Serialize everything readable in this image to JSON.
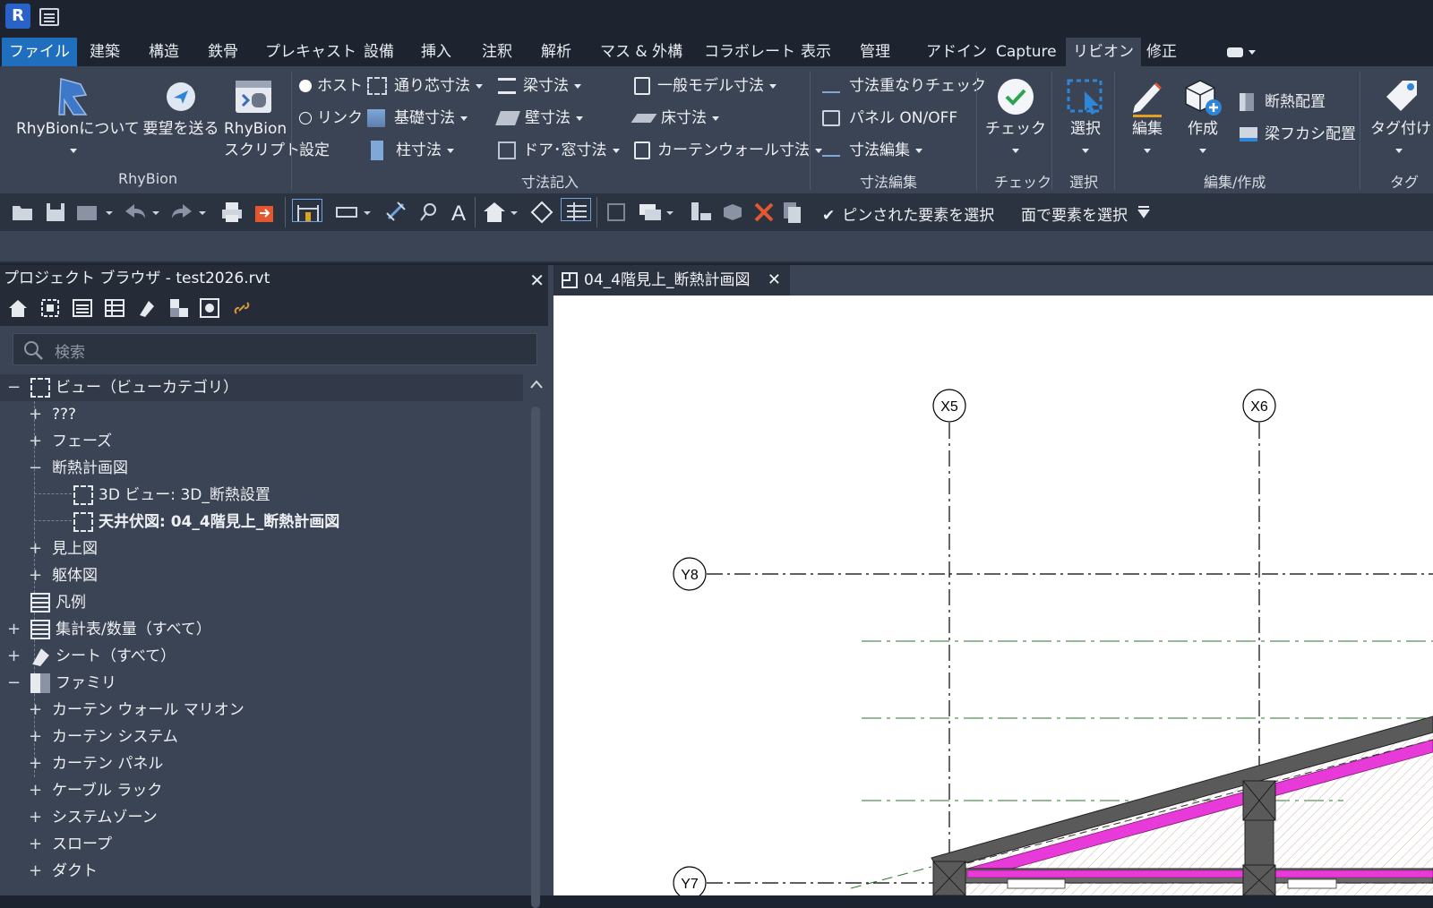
{
  "app": {
    "logo_letter": "R"
  },
  "menu_tabs": [
    "ファイル",
    "建築",
    "構造",
    "鉄骨",
    "プレキャスト",
    "設備",
    "挿入",
    "注釈",
    "解析",
    "マス & 外構",
    "コラボレート",
    "表示",
    "管理",
    "アドイン",
    "Capture",
    "リビオン",
    "修正"
  ],
  "ribbon": {
    "rhybion": {
      "about": "RhyBionについて",
      "request": "要望を送る",
      "script1": "RhyBion",
      "script2": "スクリプト",
      "panel": "RhyBion"
    },
    "host": "ホスト",
    "link": "リンク",
    "settings": "設定",
    "dim": {
      "grid": "通り芯寸法",
      "foundation": "基礎寸法",
      "column": "柱寸法",
      "beam": "梁寸法",
      "wall": "壁寸法",
      "door": "ドア･窓寸法",
      "generic": "一般モデル寸法",
      "floor": "床寸法",
      "curtain": "カーテンウォール寸法",
      "panel": "寸法記入"
    },
    "edit": {
      "overlap": "寸法重なりチェック",
      "panel_onoff": "パネル ON/OFF",
      "dim_edit": "寸法編集",
      "panel": "寸法編集"
    },
    "check": {
      "label": "チェック",
      "panel": "チェック"
    },
    "select": {
      "label": "選択",
      "panel": "選択"
    },
    "create": {
      "edit": "編集",
      "create": "作成",
      "insulation": "断熱配置",
      "beam": "梁フカシ配置",
      "panel": "編集/作成"
    },
    "tag": {
      "label": "タグ付け",
      "panel": "タグ"
    }
  },
  "toolbar": {
    "pinned": "ピンされた要素を選択",
    "face": "面で要素を選択"
  },
  "browser": {
    "title": "プロジェクト ブラウザ - test2026.rvt",
    "search_placeholder": "検索",
    "rows": [
      {
        "sign": "−",
        "label": "ビュー（ビューカテゴリ）",
        "level": 0,
        "icon": "view"
      },
      {
        "sign": "+",
        "label": "???",
        "level": 1
      },
      {
        "sign": "+",
        "label": "フェーズ",
        "level": 1
      },
      {
        "sign": "−",
        "label": "断熱計画図",
        "level": 1
      },
      {
        "sign": "",
        "label": "3D ビュー: 3D_断熱設置",
        "level": 2,
        "icon": "view"
      },
      {
        "sign": "",
        "label": "天井伏図: 04_4階見上_断熱計画図",
        "level": 2,
        "icon": "view",
        "bold": true
      },
      {
        "sign": "+",
        "label": "見上図",
        "level": 1
      },
      {
        "sign": "+",
        "label": "躯体図",
        "level": 1
      },
      {
        "sign": "",
        "label": "凡例",
        "level": 0,
        "icon": "legend"
      },
      {
        "sign": "+",
        "label": "集計表/数量（すべて）",
        "level": 0,
        "icon": "schedule"
      },
      {
        "sign": "+",
        "label": "シート（すべて）",
        "level": 0,
        "icon": "sheet"
      },
      {
        "sign": "−",
        "label": "ファミリ",
        "level": 0,
        "icon": "family"
      },
      {
        "sign": "+",
        "label": "カーテン ウォール マリオン",
        "level": 1
      },
      {
        "sign": "+",
        "label": "カーテン システム",
        "level": 1
      },
      {
        "sign": "+",
        "label": "カーテン パネル",
        "level": 1
      },
      {
        "sign": "+",
        "label": "ケーブル ラック",
        "level": 1
      },
      {
        "sign": "+",
        "label": "システムゾーン",
        "level": 1
      },
      {
        "sign": "+",
        "label": "スロープ",
        "level": 1
      },
      {
        "sign": "+",
        "label": "ダクト",
        "level": 1
      }
    ]
  },
  "view_tab": {
    "title": "04_4階見上_断熱計画図"
  },
  "grid": {
    "x5": "X5",
    "x6": "X6",
    "y8": "Y8",
    "y7": "Y7"
  },
  "colors": {
    "accent": "#1f6fbe",
    "panel": "#3b4455",
    "insulation": "#e83ad8"
  }
}
